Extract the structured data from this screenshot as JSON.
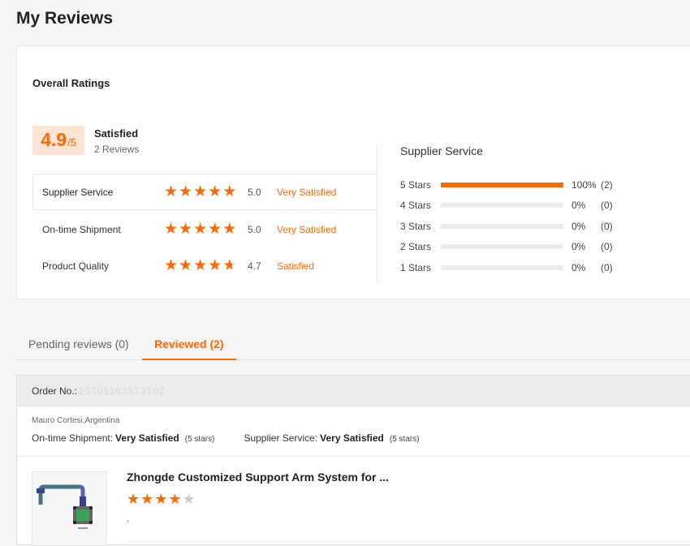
{
  "page": {
    "title": "My Reviews"
  },
  "overall": {
    "title": "Overall Ratings",
    "score": "4.9",
    "score_max": "/5",
    "label": "Satisfied",
    "count": "2 Reviews",
    "categories": [
      {
        "name": "Supplier Service",
        "stars": 5.0,
        "score": "5.0",
        "desc": "Very Satisfied"
      },
      {
        "name": "On-time Shipment",
        "stars": 5.0,
        "score": "5.0",
        "desc": "Very Satisfied"
      },
      {
        "name": "Product Quality",
        "stars": 4.7,
        "score": "4.7",
        "desc": "Satisfied"
      }
    ]
  },
  "distribution": {
    "title": "Supplier Service",
    "rows": [
      {
        "label": "5 Stars",
        "fraction": 1.0,
        "percent": "100%",
        "count": "(2)"
      },
      {
        "label": "4 Stars",
        "fraction": 0.0,
        "percent": "0%",
        "count": "(0)"
      },
      {
        "label": "3 Stars",
        "fraction": 0.0,
        "percent": "0%",
        "count": "(0)"
      },
      {
        "label": "2 Stars",
        "fraction": 0.0,
        "percent": "0%",
        "count": "(0)"
      },
      {
        "label": "1 Stars",
        "fraction": 0.0,
        "percent": "0%",
        "count": "(0)"
      }
    ]
  },
  "tabs": {
    "pending": "Pending reviews (0)",
    "reviewed": "Reviewed (2)"
  },
  "order": {
    "label": "Order No.:",
    "number": "25101163573102 ...",
    "reviewer": "Mauro Cortesi,Argentina",
    "shipment_label": "On-time Shipment:",
    "shipment_value": "Very Satisfied",
    "shipment_stars": "(5 stars)",
    "service_label": "Supplier Service:",
    "service_value": "Very Satisfied",
    "service_stars": "(5 stars)",
    "product": {
      "title": "Zhongde Customized Support Arm System for ...",
      "rating": 4,
      "comment": "."
    }
  },
  "colors": {
    "accent": "#ff6a00",
    "badge_bg": "#fde4d5",
    "bar_bg": "#ececec"
  }
}
